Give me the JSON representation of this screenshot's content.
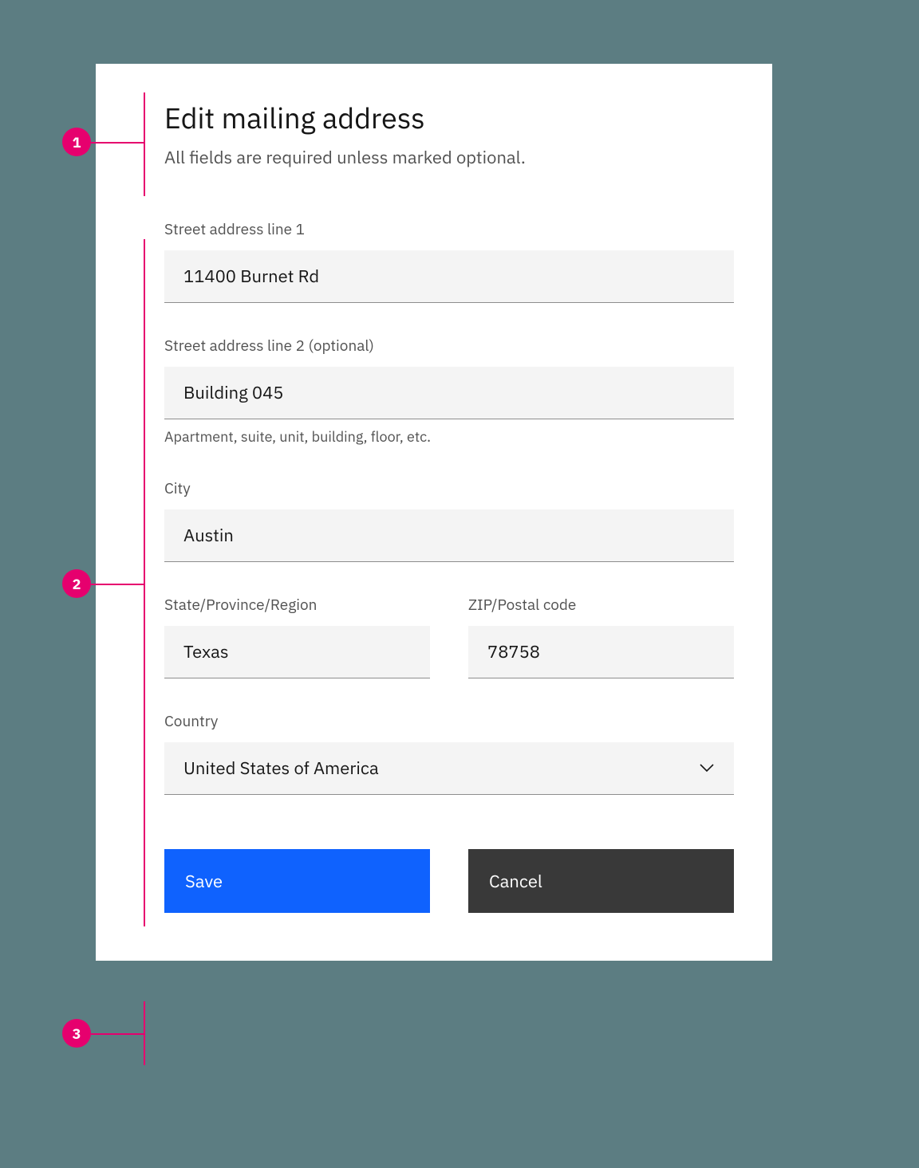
{
  "markers": {
    "m1": "1",
    "m2": "2",
    "m3": "3"
  },
  "header": {
    "title": "Edit mailing address",
    "subtitle": "All fields are required unless marked optional."
  },
  "fields": {
    "street1": {
      "label": "Street address line 1",
      "value": "11400 Burnet Rd"
    },
    "street2": {
      "label": "Street address line 2 (optional)",
      "value": "Building 045",
      "helper": "Apartment, suite, unit, building, floor, etc."
    },
    "city": {
      "label": "City",
      "value": "Austin"
    },
    "state": {
      "label": "State/Province/Region",
      "value": "Texas"
    },
    "zip": {
      "label": "ZIP/Postal code",
      "value": "78758"
    },
    "country": {
      "label": "Country",
      "value": "United States of America"
    }
  },
  "actions": {
    "primary": "Save",
    "secondary": "Cancel"
  }
}
